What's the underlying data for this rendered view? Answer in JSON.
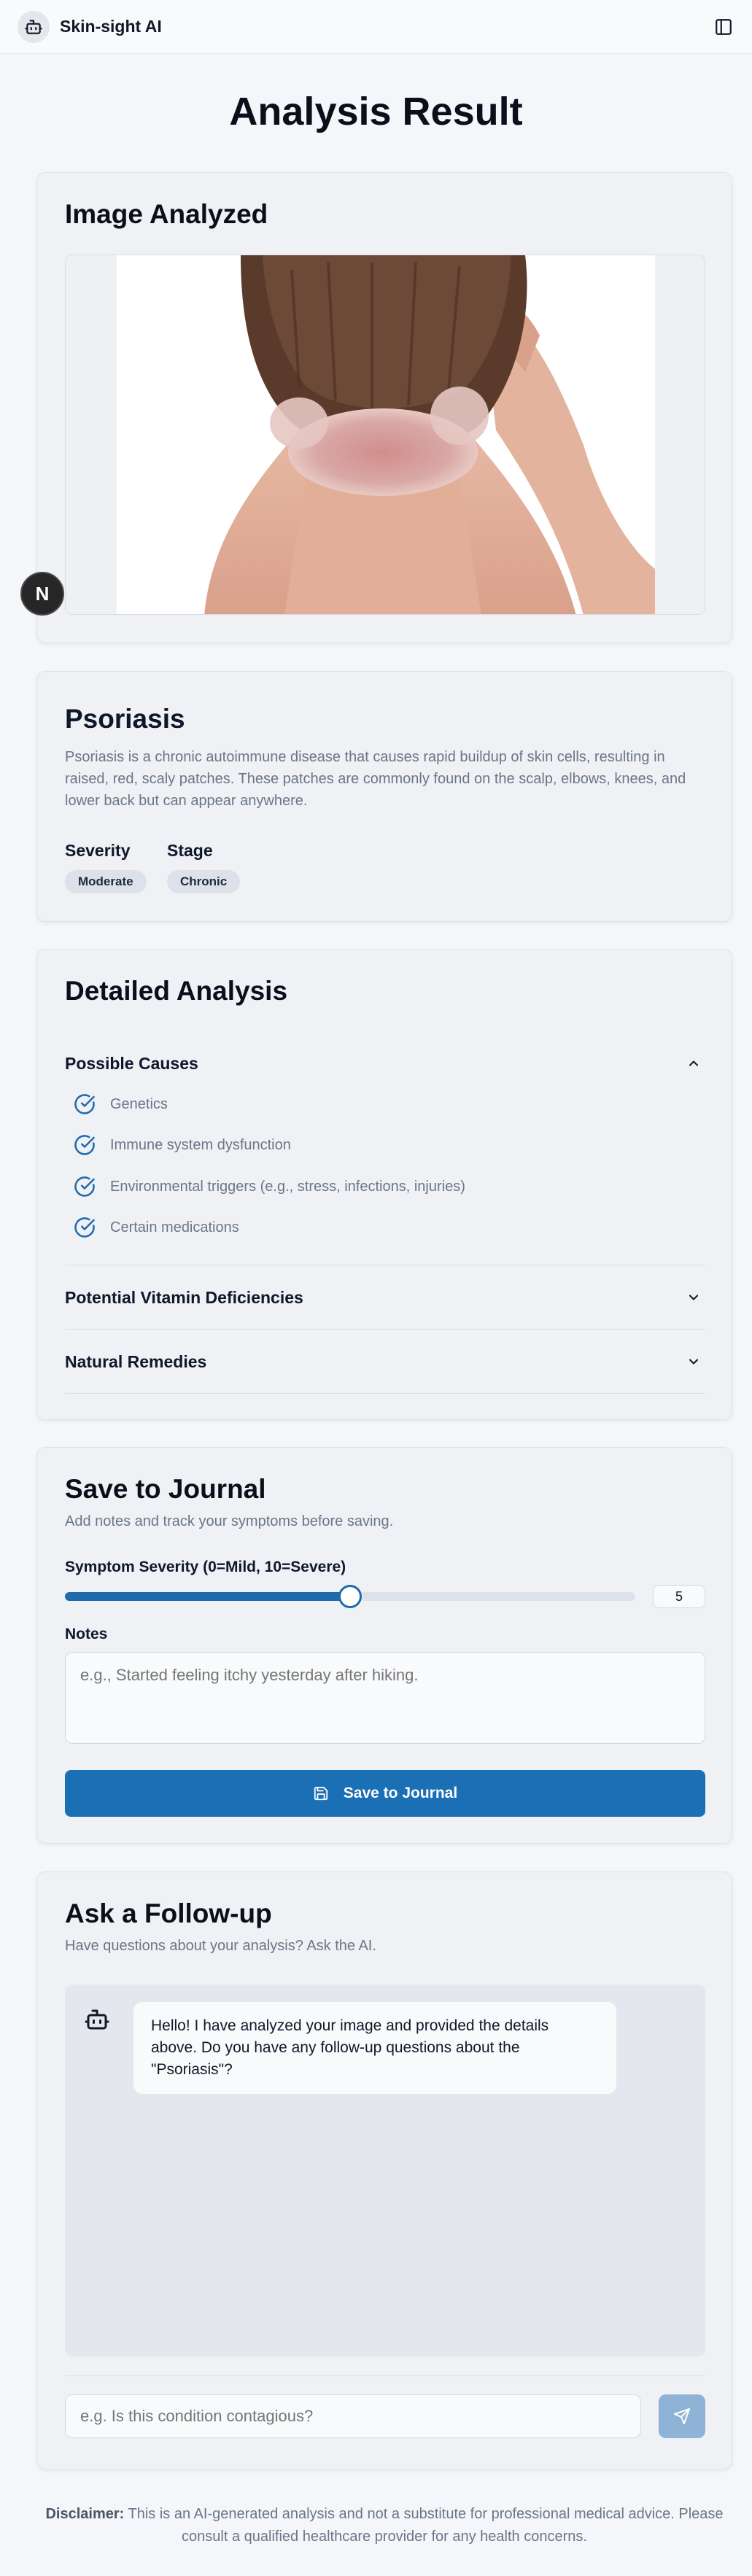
{
  "app": {
    "name": "Skin-sight AI"
  },
  "page": {
    "title": "Analysis Result"
  },
  "image_card": {
    "title": "Image Analyzed"
  },
  "dev_badge": {
    "letter": "N"
  },
  "condition": {
    "name": "Psoriasis",
    "description": "Psoriasis is a chronic autoimmune disease that causes rapid buildup of skin cells, resulting in raised, red, scaly patches. These patches are commonly found on the scalp, elbows, knees, and lower back but can appear anywhere.",
    "severity_label": "Severity",
    "severity_value": "Moderate",
    "stage_label": "Stage",
    "stage_value": "Chronic"
  },
  "analysis": {
    "title": "Detailed Analysis",
    "sections": [
      {
        "label": "Possible Causes",
        "expanded": true,
        "items": [
          "Genetics",
          "Immune system dysfunction",
          "Environmental triggers (e.g., stress, infections, injuries)",
          "Certain medications"
        ]
      },
      {
        "label": "Potential Vitamin Deficiencies",
        "expanded": false
      },
      {
        "label": "Natural Remedies",
        "expanded": false
      }
    ]
  },
  "journal": {
    "title": "Save to Journal",
    "subtitle": "Add notes and track your symptoms before saving.",
    "severity_label": "Symptom Severity (0=Mild, 10=Severe)",
    "severity_value": "5",
    "severity_fraction": 0.5,
    "notes_label": "Notes",
    "notes_placeholder": "e.g., Started feeling itchy yesterday after hiking.",
    "save_label": "Save to Journal"
  },
  "chat": {
    "title": "Ask a Follow-up",
    "subtitle": "Have questions about your analysis? Ask the AI.",
    "messages": [
      {
        "from": "bot",
        "text": "Hello! I have analyzed your image and provided the details above. Do you have any follow-up questions about the \"Psoriasis\"?"
      }
    ],
    "input_placeholder": "e.g. Is this condition contagious?"
  },
  "disclaimer": {
    "label": "Disclaimer:",
    "text": "This is an AI-generated analysis and not a substitute for professional medical advice. Please consult a qualified healthcare provider for any health concerns."
  },
  "colors": {
    "primary": "#1b6fb4",
    "send_disabled": "#8fb3d6",
    "background": "#f4f6f9"
  },
  "icons": [
    "bot-icon",
    "sidebar-toggle-icon",
    "chevron-up-icon",
    "chevron-down-icon",
    "check-circle-icon",
    "save-icon",
    "send-icon"
  ]
}
